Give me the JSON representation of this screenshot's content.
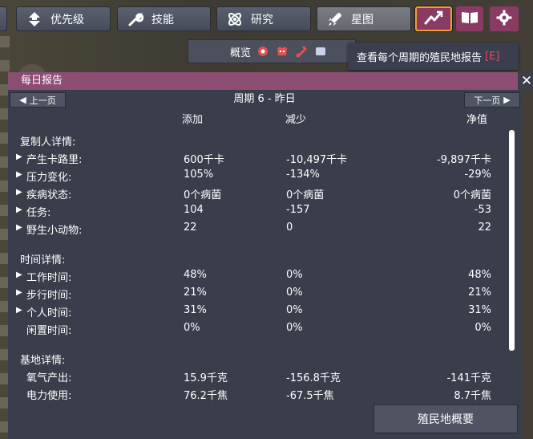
{
  "toolbar": {
    "priority_label": "优先级",
    "skills_label": "技能",
    "research_label": "研究",
    "starmap_label": "星图"
  },
  "overview": {
    "label": "概览"
  },
  "tooltip": {
    "text": "查看每个周期的殖民地报告",
    "hotkey": "[E]"
  },
  "report": {
    "title": "每日报告",
    "close": "✕",
    "prev_label": "上一页",
    "next_label": "下一页",
    "period_title": "周期 6 - 昨日",
    "col_add": "添加",
    "col_sub": "减少",
    "col_net": "净值",
    "footer_button": "殖民地概要",
    "sections": [
      {
        "title": "复制人详情:",
        "rows": [
          {
            "name": "产生卡路里:",
            "add": "600千卡",
            "sub": "-10,497千卡",
            "net": "-9,897千卡",
            "expandable": true
          },
          {
            "name": "压力变化:",
            "add": "105%",
            "sub": "-134%",
            "net": "-29%",
            "expandable": true
          },
          {
            "name": "疾病状态:",
            "add": "0个病菌",
            "sub": "0个病菌",
            "net": "0个病菌",
            "expandable": true
          },
          {
            "name": "任务:",
            "add": "104",
            "sub": "-157",
            "net": "-53",
            "expandable": true
          },
          {
            "name": "野生小动物:",
            "add": "22",
            "sub": "0",
            "net": "22",
            "expandable": true
          }
        ]
      },
      {
        "title": "时间详情:",
        "rows": [
          {
            "name": "工作时间:",
            "add": "48%",
            "sub": "0%",
            "net": "48%",
            "expandable": true
          },
          {
            "name": "步行时间:",
            "add": "21%",
            "sub": "0%",
            "net": "21%",
            "expandable": true
          },
          {
            "name": "个人时间:",
            "add": "31%",
            "sub": "0%",
            "net": "31%",
            "expandable": true
          },
          {
            "name": "闲置时间:",
            "add": "0%",
            "sub": "0%",
            "net": "0%",
            "expandable": false
          }
        ]
      },
      {
        "title": "基地详情:",
        "rows": [
          {
            "name": "氧气产出:",
            "add": "15.9千克",
            "sub": "-156.8千克",
            "net": "-141千克",
            "expandable": false
          },
          {
            "name": "电力使用:",
            "add": "76.2千焦",
            "sub": "-67.5千焦",
            "net": "8.7千焦",
            "expandable": false
          }
        ]
      }
    ]
  },
  "colors": {
    "header": "#8c4d73",
    "panel": "#3a3d4a",
    "accent_border": "#f0a030",
    "hotkey": "#e64f5b"
  }
}
